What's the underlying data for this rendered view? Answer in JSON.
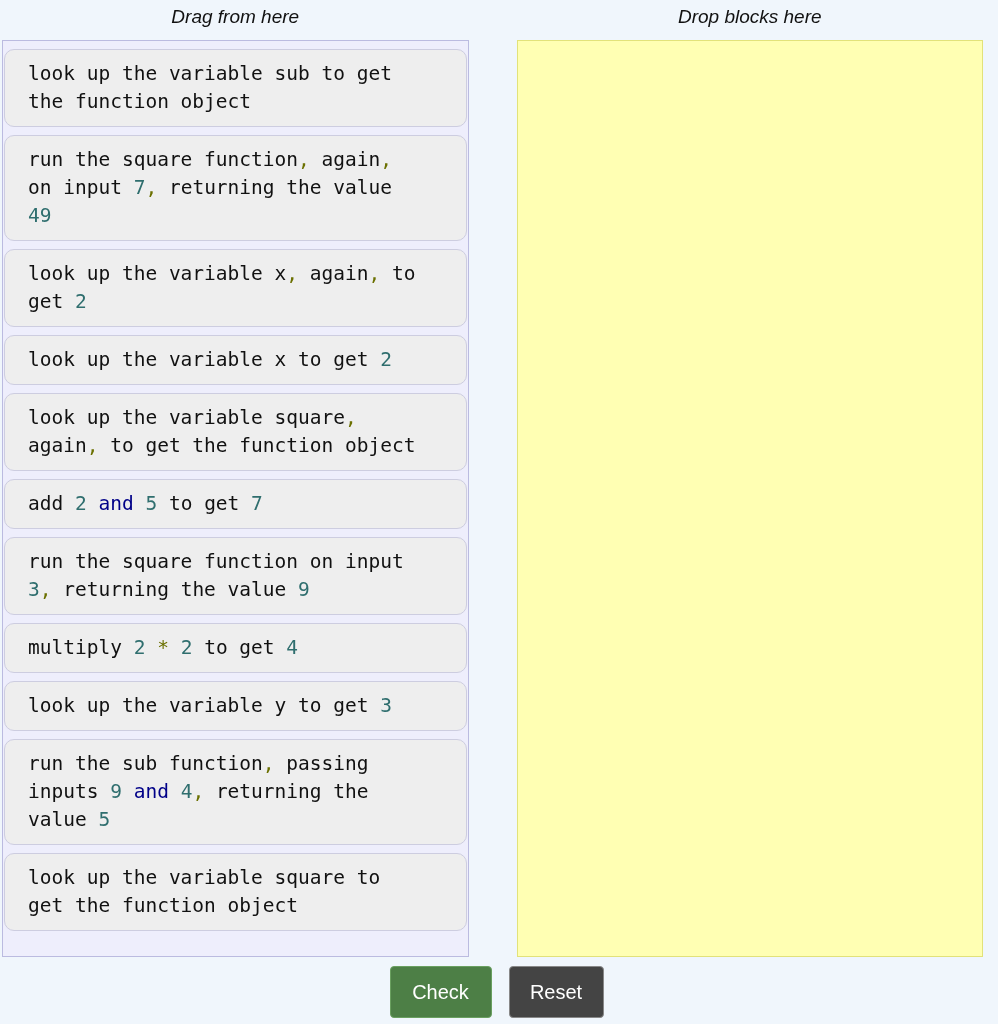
{
  "columns": [
    {
      "kind": "source",
      "heading": "Drag from here"
    },
    {
      "kind": "target",
      "heading": "Drop blocks here"
    }
  ],
  "blocks": [
    {
      "segments": [
        {
          "kind": "text",
          "text": "look up the variable sub to get the function object"
        }
      ]
    },
    {
      "segments": [
        {
          "kind": "text",
          "text": "run the square function"
        },
        {
          "kind": "punct",
          "text": ","
        },
        {
          "kind": "text",
          "text": " again"
        },
        {
          "kind": "punct",
          "text": ","
        },
        {
          "kind": "text",
          "text": " on input "
        },
        {
          "kind": "number",
          "text": "7"
        },
        {
          "kind": "punct",
          "text": ","
        },
        {
          "kind": "text",
          "text": " returning the value "
        },
        {
          "kind": "number",
          "text": "49"
        }
      ]
    },
    {
      "segments": [
        {
          "kind": "text",
          "text": "look up the variable x"
        },
        {
          "kind": "punct",
          "text": ","
        },
        {
          "kind": "text",
          "text": " again"
        },
        {
          "kind": "punct",
          "text": ","
        },
        {
          "kind": "text",
          "text": " to get "
        },
        {
          "kind": "number",
          "text": "2"
        }
      ]
    },
    {
      "segments": [
        {
          "kind": "text",
          "text": "look up the variable x to get "
        },
        {
          "kind": "number",
          "text": "2"
        }
      ]
    },
    {
      "segments": [
        {
          "kind": "text",
          "text": "look up the variable square"
        },
        {
          "kind": "punct",
          "text": ","
        },
        {
          "kind": "text",
          "text": " again"
        },
        {
          "kind": "punct",
          "text": ","
        },
        {
          "kind": "text",
          "text": " to get the function object"
        }
      ]
    },
    {
      "segments": [
        {
          "kind": "text",
          "text": "add "
        },
        {
          "kind": "number",
          "text": "2"
        },
        {
          "kind": "keyword",
          "text": " and "
        },
        {
          "kind": "number",
          "text": "5"
        },
        {
          "kind": "text",
          "text": " to get "
        },
        {
          "kind": "number",
          "text": "7"
        }
      ]
    },
    {
      "segments": [
        {
          "kind": "text",
          "text": "run the square function on input "
        },
        {
          "kind": "number",
          "text": "3"
        },
        {
          "kind": "punct",
          "text": ","
        },
        {
          "kind": "text",
          "text": " returning the value "
        },
        {
          "kind": "number",
          "text": "9"
        }
      ]
    },
    {
      "segments": [
        {
          "kind": "text",
          "text": "multiply "
        },
        {
          "kind": "number",
          "text": "2"
        },
        {
          "kind": "punct",
          "text": " * "
        },
        {
          "kind": "number",
          "text": "2"
        },
        {
          "kind": "text",
          "text": " to get "
        },
        {
          "kind": "number",
          "text": "4"
        }
      ]
    },
    {
      "segments": [
        {
          "kind": "text",
          "text": "look up the variable y to get "
        },
        {
          "kind": "number",
          "text": "3"
        }
      ]
    },
    {
      "segments": [
        {
          "kind": "text",
          "text": "run the sub function"
        },
        {
          "kind": "punct",
          "text": ","
        },
        {
          "kind": "text",
          "text": " passing inputs "
        },
        {
          "kind": "number",
          "text": "9"
        },
        {
          "kind": "keyword",
          "text": " and "
        },
        {
          "kind": "number",
          "text": "4"
        },
        {
          "kind": "punct",
          "text": ","
        },
        {
          "kind": "text",
          "text": " returning the value "
        },
        {
          "kind": "number",
          "text": "5"
        }
      ]
    },
    {
      "segments": [
        {
          "kind": "text",
          "text": "look up the variable square to get the function object"
        }
      ]
    }
  ],
  "buttons": [
    {
      "kind": "primary",
      "label": "Check"
    },
    {
      "kind": "secondary",
      "label": "Reset"
    }
  ]
}
